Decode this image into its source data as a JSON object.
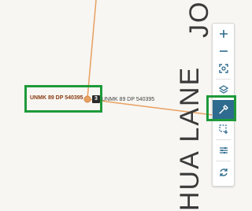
{
  "map": {
    "street_labels": [
      "JO",
      "HUA LANE"
    ],
    "callout_label": "UNMK 89 DP 540395",
    "cluster_count": "3",
    "point_label": "UNMK 89 DP 540395",
    "colors": {
      "background": "#f7f6f2",
      "road_line": "#e8a060",
      "callout_border": "#1e9a3a",
      "active_tool": "#2e6b8e",
      "icon": "#2e6b8e"
    }
  },
  "toolbar": {
    "items": [
      {
        "name": "zoom-in",
        "icon": "plus-icon"
      },
      {
        "name": "zoom-out",
        "icon": "minus-icon"
      },
      {
        "name": "focus",
        "icon": "focus-frame-icon"
      },
      {
        "name": "layers",
        "icon": "layers-icon"
      },
      {
        "name": "pick",
        "icon": "eyedropper-icon",
        "active": true
      },
      {
        "name": "select-area",
        "icon": "select-area-icon"
      },
      {
        "name": "settings",
        "icon": "sliders-icon"
      },
      {
        "name": "refresh",
        "icon": "refresh-icon"
      }
    ]
  }
}
